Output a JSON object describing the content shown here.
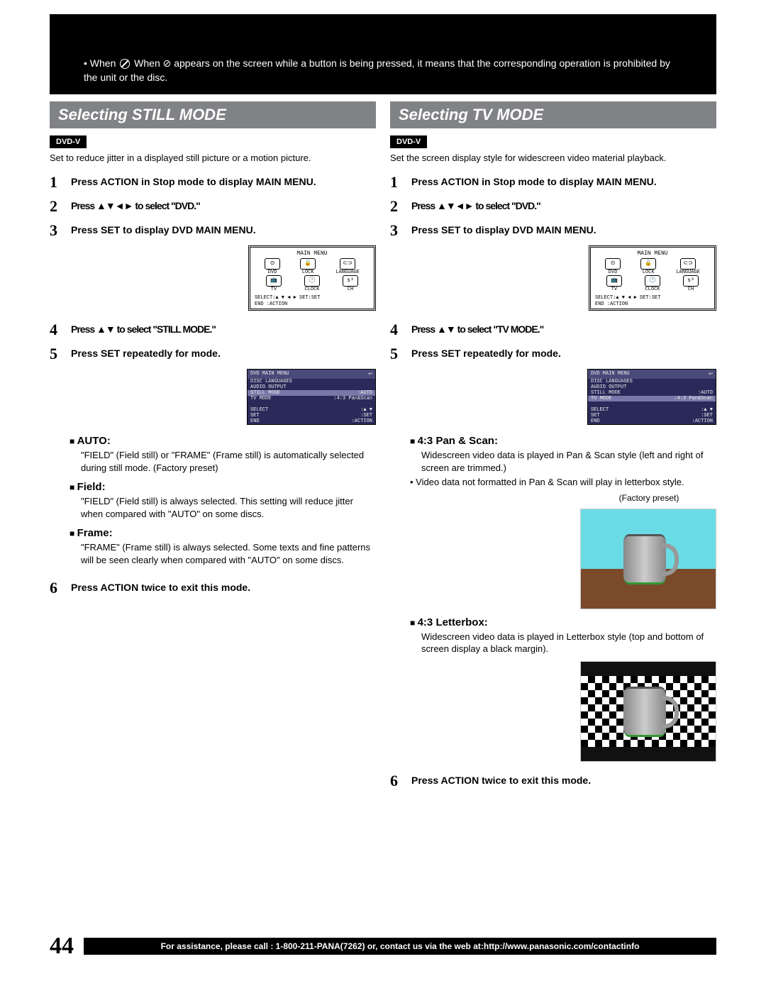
{
  "banner": "When ⊘ appears on the screen while a button is being pressed, it means that the corresponding operation is prohibited by the unit or the disc.",
  "left": {
    "heading": "Selecting STILL MODE",
    "badge": "DVD-V",
    "intro": "Set to reduce jitter in a displayed still picture or a motion picture.",
    "steps1": [
      "Press ACTION in Stop mode to display MAIN MENU.",
      "Press ▲▼◄► to select \"DVD.\"",
      "Press SET to display DVD MAIN MENU."
    ],
    "main_menu": {
      "title": "MAIN MENU",
      "items": [
        "DVD",
        "LOCK",
        "LANGUAGE",
        "TV",
        "CLOCK",
        "CH"
      ],
      "foot1": "SELECT:▲ ▼ ◄ ►   SET:SET",
      "foot2": "END    :ACTION"
    },
    "steps2": [
      "Press ▲▼ to select \"STILL MODE.\"",
      "Press SET repeatedly for mode."
    ],
    "dvd_menu": {
      "title": "DVD MAIN MENU",
      "rows": [
        [
          "DISC LANGUAGES",
          ""
        ],
        [
          "AUDIO OUTPUT",
          ""
        ],
        [
          "STILL MODE",
          ":AUTO"
        ],
        [
          "TV MODE",
          ":4:3 Pan&Scan"
        ]
      ],
      "hl_index": 2,
      "foot": [
        [
          "SELECT",
          ":▲ ▼"
        ],
        [
          "SET",
          ":SET"
        ],
        [
          "END",
          ":ACTION"
        ]
      ]
    },
    "options": [
      {
        "head": "AUTO:",
        "body": "\"FIELD\" (Field still) or \"FRAME\" (Frame still) is automatically selected during still mode. (Factory preset)"
      },
      {
        "head": "Field:",
        "body": "\"FIELD\" (Field still) is always selected. This setting will reduce jitter when compared with \"AUTO\" on some discs."
      },
      {
        "head": "Frame:",
        "body": "\"FRAME\" (Frame still) is always selected. Some texts and fine patterns will be seen clearly when compared with \"AUTO\" on some discs."
      }
    ],
    "step6": "Press ACTION twice to exit this mode."
  },
  "right": {
    "heading": "Selecting TV MODE",
    "badge": "DVD-V",
    "intro": "Set the screen display style for widescreen video material playback.",
    "steps1": [
      "Press ACTION in Stop mode to display MAIN MENU.",
      "Press ▲▼◄► to select \"DVD.\"",
      "Press SET to display DVD MAIN MENU."
    ],
    "main_menu": {
      "title": "MAIN MENU",
      "items": [
        "DVD",
        "LOCK",
        "LANGUAGE",
        "TV",
        "CLOCK",
        "CH"
      ],
      "foot1": "SELECT:▲ ▼ ◄ ►   SET:SET",
      "foot2": "END    :ACTION"
    },
    "steps2": [
      "Press ▲▼ to select \"TV MODE.\"",
      "Press SET repeatedly for mode."
    ],
    "dvd_menu": {
      "title": "DVD MAIN MENU",
      "rows": [
        [
          "DISC LANGUAGES",
          ""
        ],
        [
          "AUDIO OUTPUT",
          ""
        ],
        [
          "STILL MODE",
          ":AUTO"
        ],
        [
          "TV MODE",
          ":4:3 Pan&Scan"
        ]
      ],
      "hl_index": 3,
      "foot": [
        [
          "SELECT",
          ":▲ ▼"
        ],
        [
          "SET",
          ":SET"
        ],
        [
          "END",
          ":ACTION"
        ]
      ]
    },
    "opt_panscan_head": "4:3 Pan & Scan:",
    "opt_panscan_body1": "Widescreen video data is played in Pan & Scan style (left and right of screen are trimmed.)",
    "opt_panscan_body2": "Video data not formatted in Pan & Scan will play in letterbox style.",
    "factory_preset": "(Factory preset)",
    "opt_letterbox_head": "4:3 Letterbox:",
    "opt_letterbox_body": "Widescreen video data is played in Letterbox style (top and bottom of screen display a  black margin).",
    "step6": "Press ACTION twice to exit this mode."
  },
  "footer": {
    "page": "44",
    "bar": "For assistance, please call : 1-800-211-PANA(7262) or, contact us via the web at:http://www.panasonic.com/contactinfo"
  }
}
